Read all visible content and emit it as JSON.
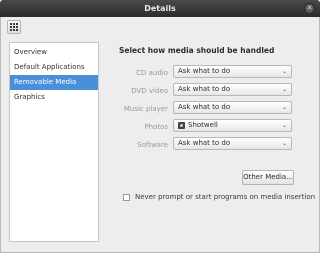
{
  "window": {
    "title": "Details",
    "close_glyph": "✕"
  },
  "toolbar": {
    "icon": "grid-icon"
  },
  "sidebar": {
    "items": [
      {
        "label": "Overview",
        "selected": false
      },
      {
        "label": "Default Applications",
        "selected": false
      },
      {
        "label": "Removable Media",
        "selected": true
      },
      {
        "label": "Graphics",
        "selected": false
      }
    ]
  },
  "media": {
    "heading": "Select how media should be handled",
    "rows": [
      {
        "label": "CD audio",
        "value": "Ask what to do"
      },
      {
        "label": "DVD video",
        "value": "Ask what to do"
      },
      {
        "label": "Music player",
        "value": "Ask what to do"
      },
      {
        "label": "Photos",
        "value": "Shotwell",
        "icon": "shotwell-icon"
      },
      {
        "label": "Software",
        "value": "Ask what to do"
      }
    ],
    "other_button": "Other Media...",
    "never_prompt": {
      "label": "Never prompt or start programs on media insertion",
      "checked": false
    },
    "dropdown_arrow": "⌄"
  },
  "colors": {
    "selection": "#4a90d9",
    "titlebar": "#3a3a3a"
  }
}
